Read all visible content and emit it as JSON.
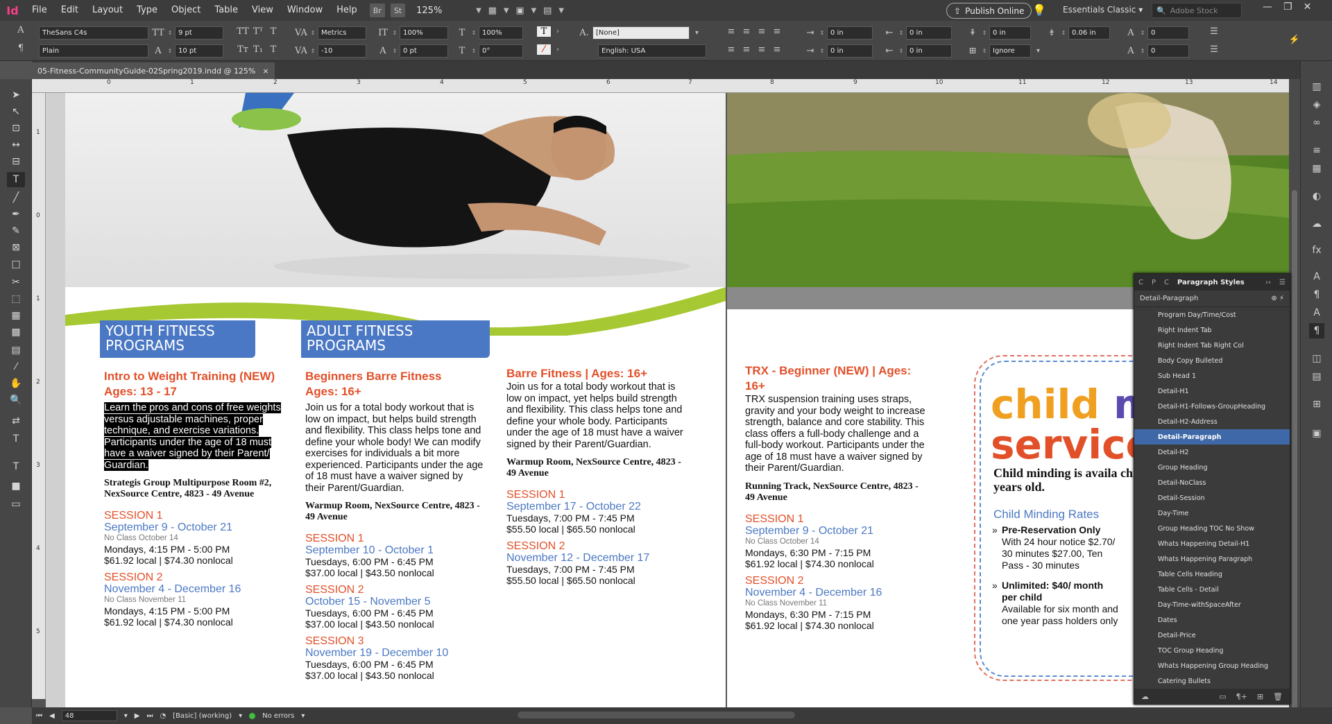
{
  "app": {
    "logo": "Id",
    "menu": [
      "File",
      "Edit",
      "Layout",
      "Type",
      "Object",
      "Table",
      "View",
      "Window",
      "Help"
    ],
    "bridge": "Br",
    "stock_btn": "St",
    "zoom": "125%",
    "publish": "Publish Online",
    "workspace": "Essentials Classic",
    "stock_placeholder": "Adobe Stock"
  },
  "control": {
    "font": "TheSans C4s",
    "style": "Plain",
    "size": "9 pt",
    "leading": "10 pt",
    "kerning": "Metrics",
    "tracking": "-10",
    "vscale": "100%",
    "hscale": "100%",
    "baseline": "0 pt",
    "skew": "0°",
    "char_style": "[None]",
    "language": "English: USA",
    "indent_left": "0 in",
    "indent_first": "0 in",
    "indent_right": "0 in",
    "indent_last": "0 in",
    "space_before": "0 in",
    "space_after": "0.06 in",
    "drop_lines": "0",
    "drop_chars": "0",
    "grid": "Ignore"
  },
  "doc": {
    "tab": "05-Fitness-CommunityGuide-02Spring2019.indd @ 125%",
    "close": "×"
  },
  "ruler": {
    "h": [
      "0",
      "1",
      "2",
      "3",
      "4",
      "5",
      "6",
      "7",
      "8",
      "9",
      "10",
      "11",
      "12",
      "13",
      "14"
    ],
    "v": [
      "1",
      "0",
      "1",
      "2",
      "3",
      "4",
      "5"
    ]
  },
  "left": {
    "youth_head": "YOUTH FITNESS PROGRAMS",
    "adult_head": "ADULT FITNESS PROGRAMS",
    "c1": {
      "title": "Intro to Weight Training (NEW)",
      "ages": "Ages: 13 - 17",
      "desc": "Learn the pros and cons of free weights versus adjustable machines, proper technique, and exercise variations. Participants under the age of 18 must have a waiver signed by their Parent/ Guardian.",
      "loc": "Strategis Group Multipurpose Room #2, NexSource Centre, 4823 - 49 Avenue",
      "s1": "SESSION 1",
      "s1d": "September 9 - October 21",
      "s1n": "No Class October 14",
      "s1t": "Mondays, 4:15 PM - 5:00 PM",
      "s1p": "$61.92 local | $74.30 nonlocal",
      "s2": "SESSION 2",
      "s2d": "November 4 - December 16",
      "s2n": "No Class November 11",
      "s2t": "Mondays, 4:15 PM - 5:00 PM",
      "s2p": "$61.92 local | $74.30 nonlocal"
    },
    "c2": {
      "title": "Beginners Barre Fitness",
      "ages": "Ages: 16+",
      "desc": "Join us for a total body workout that is low on impact, but helps build strength and flexibility. This class helps tone and define your whole body! We can modify exercises for individuals a bit more experienced. Participants under the age of 18 must have a waiver signed by their Parent/Guardian.",
      "loc": "Warmup Room, NexSource Centre, 4823 - 49 Avenue",
      "s1": "SESSION 1",
      "s1d": "September 10 - October 1",
      "s1t": "Tuesdays, 6:00 PM - 6:45 PM",
      "s1p": "$37.00 local | $43.50 nonlocal",
      "s2": "SESSION 2",
      "s2d": "October 15 - November 5",
      "s2t": "Tuesdays, 6:00 PM - 6:45 PM",
      "s2p": "$37.00 local | $43.50 nonlocal",
      "s3": "SESSION 3",
      "s3d": "November 19 - December 10",
      "s3t": "Tuesdays, 6:00 PM - 6:45 PM",
      "s3p": "$37.00 local | $43.50 nonlocal"
    },
    "c3": {
      "title": "Barre Fitness | Ages: 16+",
      "desc": "Join us for a total body workout that is low on impact, yet helps build strength and flexibility. This class helps tone and define your whole body. Participants under the age of 18 must have a waiver signed by their Parent/Guardian.",
      "loc": "Warmup Room, NexSource Centre, 4823 - 49 Avenue",
      "s1": "SESSION 1",
      "s1d": "September 17 - October 22",
      "s1t": "Tuesdays, 7:00 PM - 7:45 PM",
      "s1p": "$55.50 local | $65.50 nonlocal",
      "s2": "SESSION 2",
      "s2d": "November 12 - December 17",
      "s2t": "Tuesdays, 7:00 PM - 7:45 PM",
      "s2p": "$55.50 local | $65.50 nonlocal"
    }
  },
  "right": {
    "trx": {
      "title": "TRX - Beginner (NEW) | Ages: 16+",
      "desc": "TRX suspension training uses straps, gravity and your body weight to increase strength, balance and core stability. This class offers a full-body challenge and a full-body workout. Participants under the age of 18 must have a waiver signed by their Parent/Guardian.",
      "loc": "Running Track, NexSource Centre, 4823 - 49 Avenue",
      "s1": "SESSION 1",
      "s1d": "September 9 - October 21",
      "s1n": "No Class October 14",
      "s1t": "Mondays, 6:30 PM - 7:15 PM",
      "s1p": "$61.92 local | $74.30 nonlocal",
      "s2": "SESSION 2",
      "s2d": "November 4 - December 16",
      "s2n": "No Class November 11",
      "s2t": "Mondays, 6:30 PM - 7:15 PM",
      "s2p": "$61.92 local | $74.30 nonlocal"
    },
    "child": {
      "word1": "child",
      "word2": "m",
      "word3": "services",
      "sub": "Child minding is availa children between the a and seven years old.",
      "rates_head": "Child Minding Rates",
      "b1": "Pre-Reservation Only",
      "b1t": "With 24 hour notice $2.70/ 30 minutes $27.00, Ten Pass - 30 minutes",
      "b2": "Unlimited: $40/ month per child",
      "b2t": "Available for six month and one year pass holders only"
    }
  },
  "panel": {
    "tabs": [
      "C",
      "P",
      "C"
    ],
    "title": "Paragraph Styles",
    "current": "Detail-Paragraph",
    "styles": [
      "Program Day/Time/Cost",
      "Right Indent Tab",
      "Right Indent Tab Right Col",
      "Body Copy Bulleted",
      "Sub Head 1",
      "Detail-H1",
      "Detail-H1-Follows-GroupHeading",
      "Detail-H2-Address",
      "Detail-Paragraph",
      "Detail-H2",
      "Group Heading",
      "Detail-NoClass",
      "Detail-Session",
      "Day-Time",
      "Group Heading TOC No Show",
      "Whats Happening Detail-H1",
      "Whats Happening Paragraph",
      "Table Cells Heading",
      "Table Cells - Detail",
      "Day-Time-withSpaceAfter",
      "Dates",
      "Detail-Price",
      "TOC Group Heading",
      "Whats Happening Group Heading",
      "Catering Bullets"
    ],
    "selected_index": 8
  },
  "status": {
    "page": "48",
    "profile": "[Basic] (working)",
    "errors": "No errors"
  },
  "colors": {
    "orange": "#e2502a",
    "blue": "#4b78c4",
    "green": "#a6c832",
    "child_orange": "#f0a020",
    "child_purple": "#5b4bb0"
  }
}
